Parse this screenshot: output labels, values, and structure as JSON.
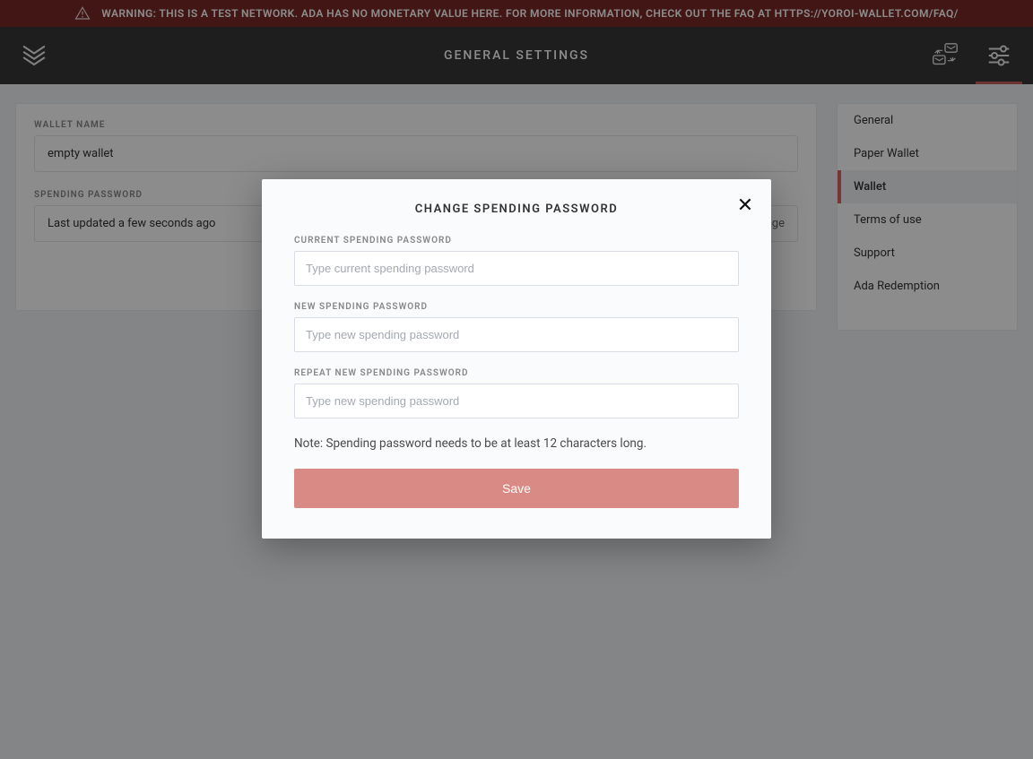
{
  "banner": {
    "text": "WARNING: THIS IS A TEST NETWORK. ADA HAS NO MONETARY VALUE HERE. FOR MORE INFORMATION, CHECK OUT THE FAQ AT HTTPS://YOROI-WALLET.COM/FAQ/"
  },
  "header": {
    "title": "GENERAL SETTINGS"
  },
  "sidebar": {
    "items": [
      {
        "label": "General",
        "active": false
      },
      {
        "label": "Paper Wallet",
        "active": false
      },
      {
        "label": "Wallet",
        "active": true
      },
      {
        "label": "Terms of use",
        "active": false
      },
      {
        "label": "Support",
        "active": false
      },
      {
        "label": "Ada Redemption",
        "active": false
      }
    ]
  },
  "main": {
    "wallet_name_label": "WALLET NAME",
    "wallet_name_value": "empty wallet",
    "spending_password_label": "SPENDING PASSWORD",
    "spending_password_value": "Last updated a few seconds ago",
    "change_text": "change"
  },
  "modal": {
    "title": "CHANGE SPENDING PASSWORD",
    "current_label": "CURRENT SPENDING PASSWORD",
    "current_placeholder": "Type current spending password",
    "new_label": "NEW SPENDING PASSWORD",
    "new_placeholder": "Type new spending password",
    "repeat_label": "REPEAT NEW SPENDING PASSWORD",
    "repeat_placeholder": "Type new spending password",
    "note": "Note: Spending password needs to be at least 12 characters long.",
    "save": "Save"
  }
}
